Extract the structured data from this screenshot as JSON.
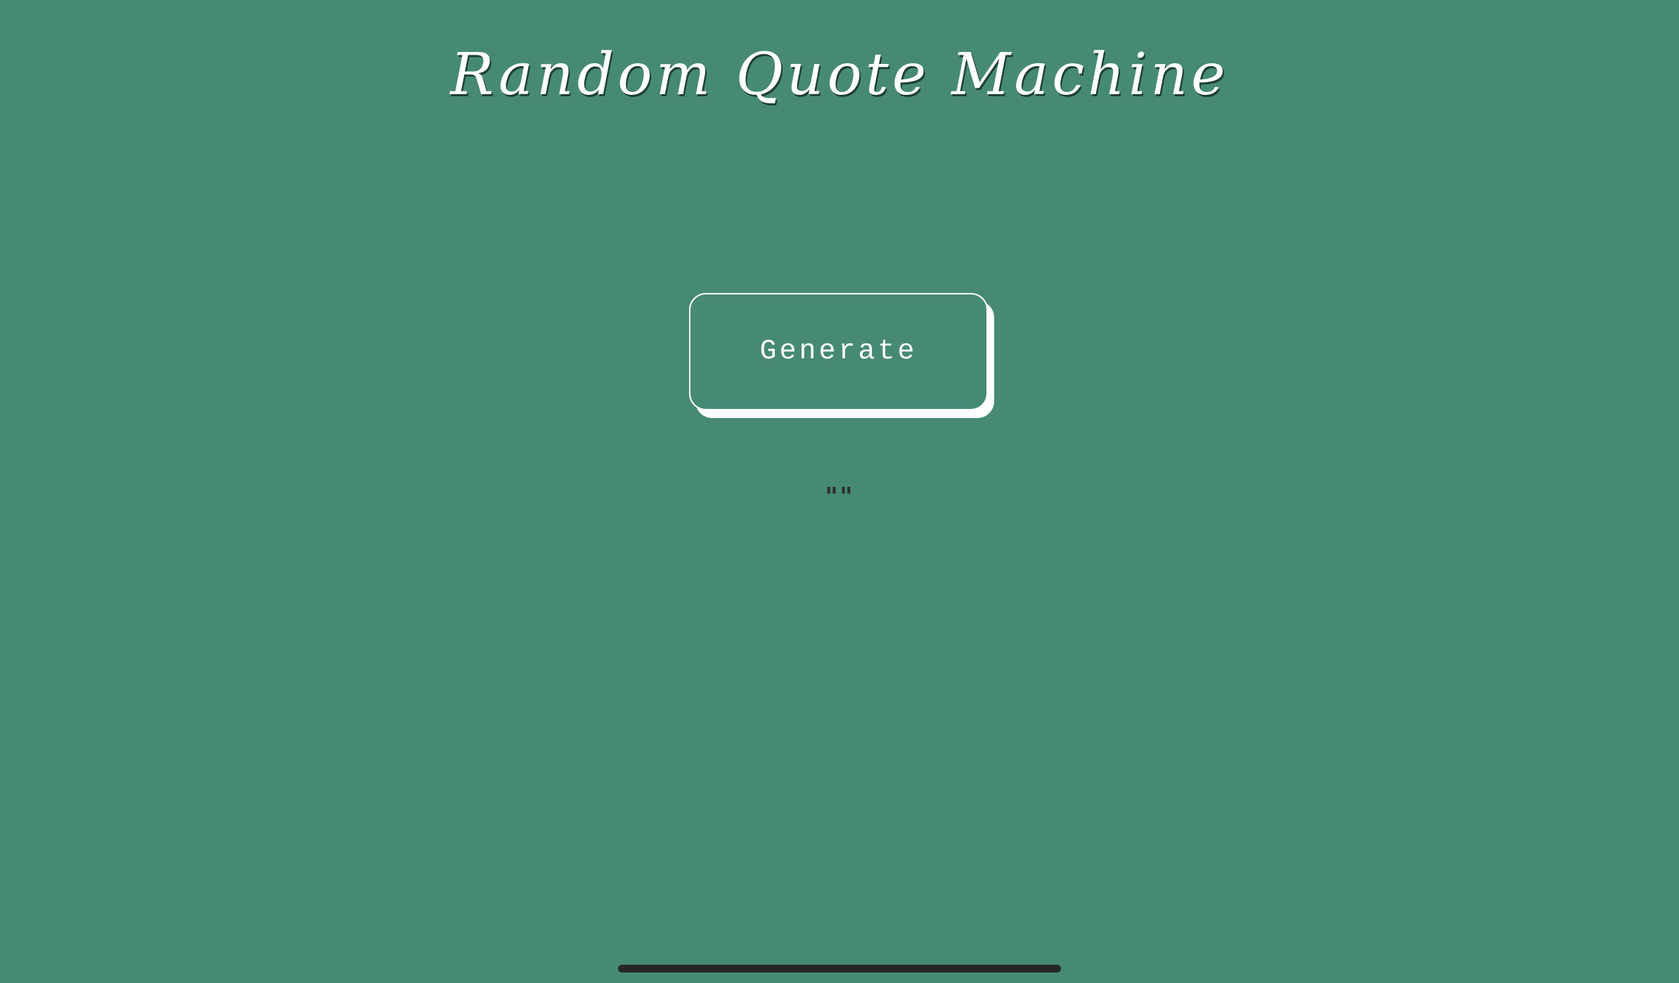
{
  "app": {
    "title": "Random Quote Machine"
  },
  "controls": {
    "generate_label": "Generate"
  },
  "quote": {
    "text": "\"\""
  },
  "colors": {
    "background": "#468a76",
    "text": "#ffffff",
    "quote_mark": "#2b2d2c",
    "home_indicator": "#262626"
  }
}
